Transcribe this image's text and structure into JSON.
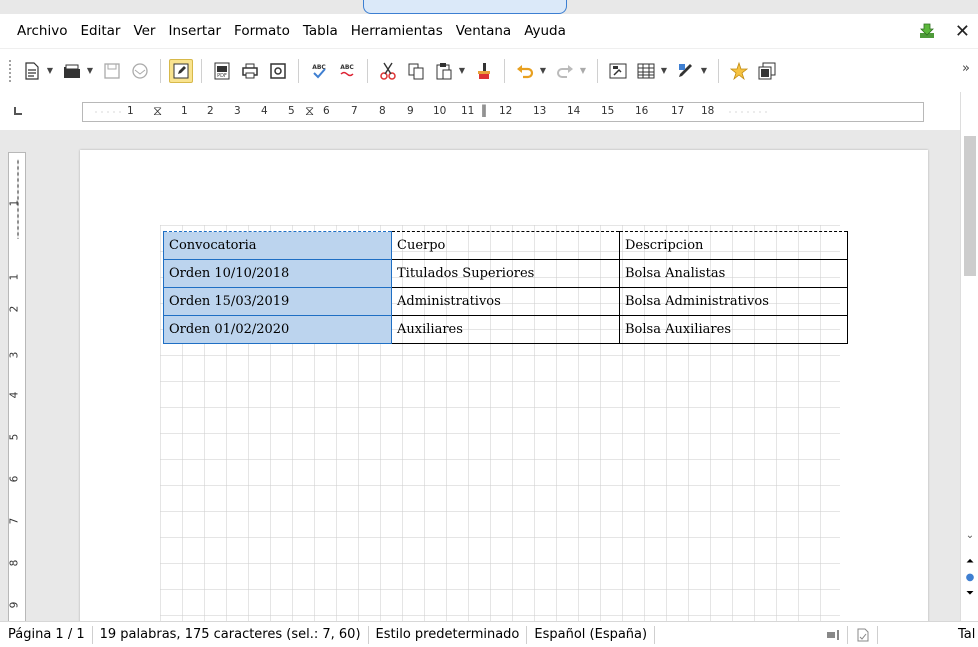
{
  "menubar": {
    "items": [
      "Archivo",
      "Editar",
      "Ver",
      "Insertar",
      "Formato",
      "Tabla",
      "Herramientas",
      "Ventana",
      "Ayuda"
    ]
  },
  "toolbar": {
    "more": "»",
    "icons": [
      "new-doc-icon",
      "open-folder-icon",
      "save-icon",
      "mail-icon",
      "edit-mode-icon",
      "export-pdf-icon",
      "print-icon",
      "print-preview-icon",
      "spellcheck-icon",
      "autospellcheck-icon",
      "cut-icon",
      "copy-icon",
      "paste-icon",
      "clone-format-icon",
      "undo-icon",
      "redo-icon",
      "navigator-icon",
      "table-icon",
      "draw-icon",
      "star-icon",
      "gallery-icon"
    ]
  },
  "ruler": {
    "h_labels": [
      "1",
      "1",
      "2",
      "3",
      "4",
      "5",
      "6",
      "7",
      "8",
      "9",
      "10",
      "11",
      "12",
      "13",
      "14",
      "15",
      "16",
      "17",
      "18"
    ],
    "v_labels": [
      "1",
      "1",
      "2",
      "3",
      "4",
      "5",
      "6",
      "7",
      "8",
      "9"
    ]
  },
  "document": {
    "table": {
      "rows": [
        [
          "Convocatoria",
          "Cuerpo",
          "Descripcion"
        ],
        [
          "Orden 10/10/2018",
          "Titulados Superiores",
          "Bolsa Analistas"
        ],
        [
          "Orden 15/03/2019",
          "Administrativos",
          "Bolsa Administrativos"
        ],
        [
          "Orden 01/02/2020",
          "Auxiliares",
          "Bolsa Auxiliares"
        ]
      ],
      "selected_column": 0,
      "selected_color": "#bcd4ee"
    }
  },
  "statusbar": {
    "page": "Página 1 / 1",
    "words": "19 palabras, 175 caracteres (sel.: 7, 60)",
    "style": "Estilo predeterminado",
    "language": "Español (España)",
    "last": "Tal"
  },
  "colors": {
    "accent": "#1f6fc4",
    "active_button": "#f9e38f"
  }
}
